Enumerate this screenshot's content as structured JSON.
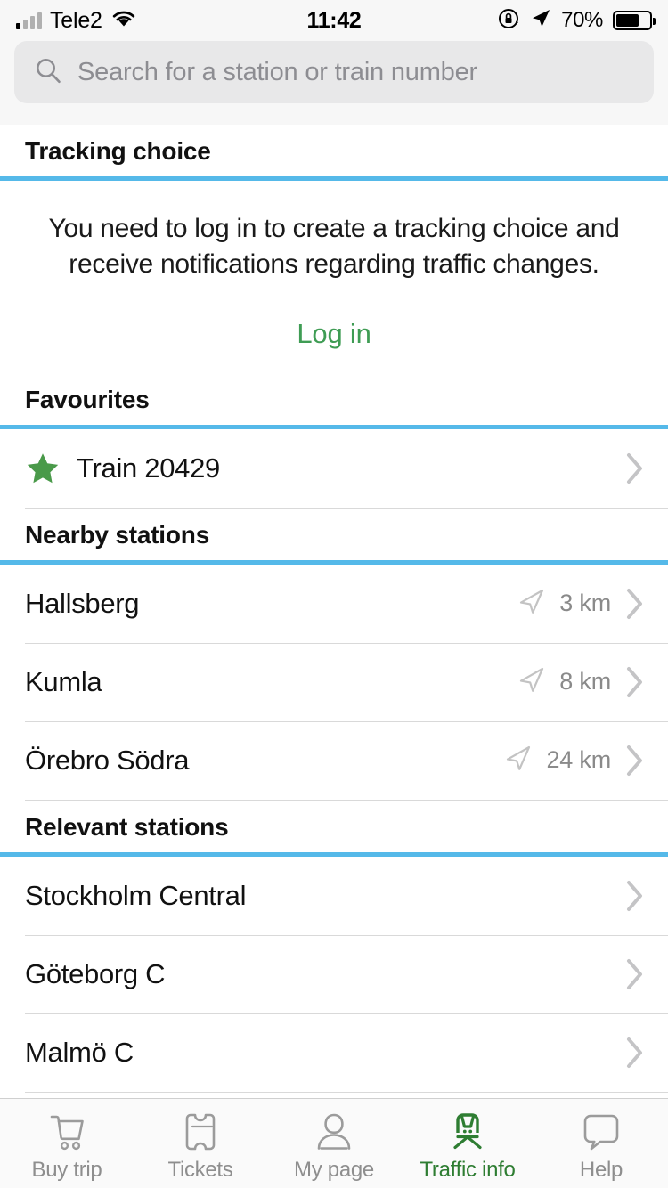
{
  "statusbar": {
    "carrier": "Tele2",
    "time": "11:42",
    "battery_pct": "70%",
    "icons": [
      "signal-bars-icon",
      "wifi-icon",
      "rotation-lock-icon",
      "location-arrow-icon",
      "battery-icon"
    ]
  },
  "search": {
    "placeholder": "Search for a station or train number",
    "value": ""
  },
  "colors": {
    "accent_blue": "#55b9e9",
    "green": "#3f9c54",
    "tab_active_green": "#2e7d32",
    "star_green": "#4a9a4a",
    "muted_gray": "#8a8a8a"
  },
  "sections": [
    {
      "id": "tracking-choice",
      "title": "Tracking choice",
      "info_text": "You need to log in to create a tracking choice and receive notifications regarding traffic changes.",
      "login_label": "Log in"
    },
    {
      "id": "favourites",
      "title": "Favourites",
      "rows": [
        {
          "label": "Train 20429",
          "star": true,
          "distance": "",
          "chevron": true
        }
      ]
    },
    {
      "id": "nearby-stations",
      "title": "Nearby stations",
      "rows": [
        {
          "label": "Hallsberg",
          "star": false,
          "distance": "3 km",
          "chevron": true
        },
        {
          "label": "Kumla",
          "star": false,
          "distance": "8 km",
          "chevron": true
        },
        {
          "label": "Örebro Södra",
          "star": false,
          "distance": "24 km",
          "chevron": true
        }
      ]
    },
    {
      "id": "relevant-stations",
      "title": "Relevant stations",
      "rows": [
        {
          "label": "Stockholm Central",
          "star": false,
          "distance": "",
          "chevron": true
        },
        {
          "label": "Göteborg C",
          "star": false,
          "distance": "",
          "chevron": true
        },
        {
          "label": "Malmö C",
          "star": false,
          "distance": "",
          "chevron": true
        }
      ]
    }
  ],
  "tabbar": {
    "items": [
      {
        "label": "Buy trip",
        "icon": "shopping-cart-icon",
        "active": false
      },
      {
        "label": "Tickets",
        "icon": "ticket-icon",
        "active": false
      },
      {
        "label": "My page",
        "icon": "person-icon",
        "active": false
      },
      {
        "label": "Traffic info",
        "icon": "train-icon",
        "active": true
      },
      {
        "label": "Help",
        "icon": "speech-bubble-icon",
        "active": false
      }
    ]
  }
}
